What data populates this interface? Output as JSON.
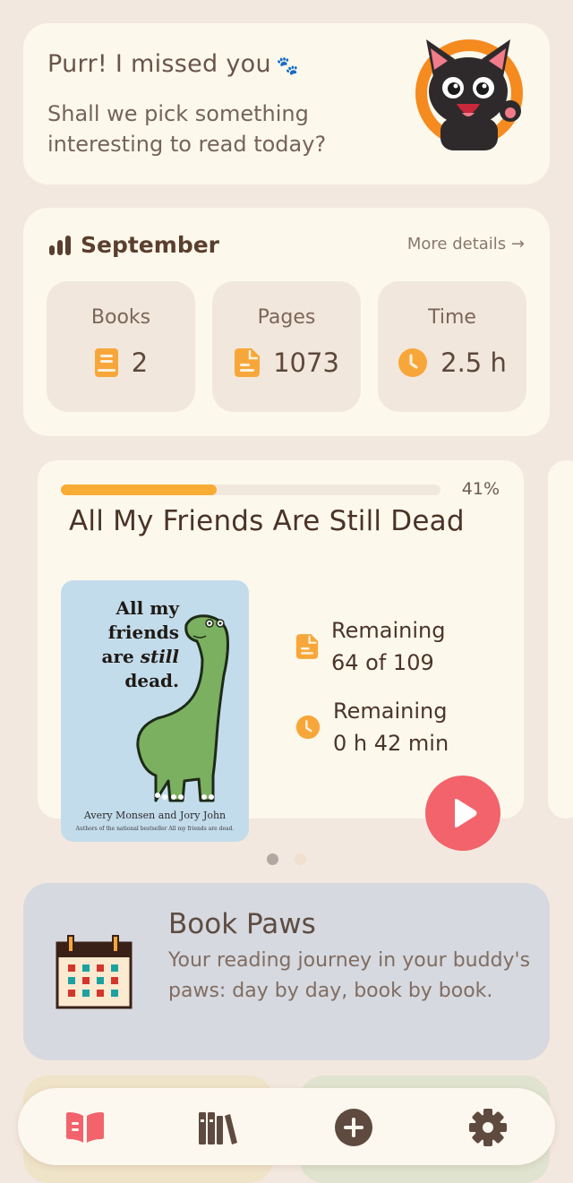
{
  "greeting": {
    "title": "Purr! I missed you",
    "paw": "🐾",
    "subtitle": "Shall we pick something interesting to read today?",
    "mascot_icon": "waving-black-cat"
  },
  "stats": {
    "month": "September",
    "more_details": "More details →",
    "items": [
      {
        "label": "Books",
        "value": "2",
        "icon": "book-icon"
      },
      {
        "label": "Pages",
        "value": "1073",
        "icon": "page-icon"
      },
      {
        "label": "Time",
        "value": "2.5 h",
        "icon": "clock-icon"
      }
    ]
  },
  "current_book": {
    "progress_percent": 41,
    "progress_label": "41%",
    "title": "All My Friends Are Still Dead",
    "cover": {
      "title_line1": "All my",
      "title_line2": "friends",
      "title_line3_a": "are ",
      "title_line3_b": "still",
      "title_line4": "dead.",
      "authors": "Avery Monsen and Jory John",
      "tagline": "Authors of the national bestseller All my friends are dead."
    },
    "pages_label": "Remaining",
    "pages_value": "64 of 109",
    "time_label": "Remaining",
    "time_value": "0 h 42 min"
  },
  "carousel": {
    "active_index": 0,
    "count": 2
  },
  "book_paws": {
    "title": "Book Paws",
    "description": "Your reading journey in your buddy's paws: day by day, book by book."
  },
  "nav": {
    "items": [
      "reading-icon",
      "library-icon",
      "add-icon",
      "settings-icon"
    ],
    "active": "reading-icon"
  },
  "colors": {
    "background": "#f3e8df",
    "card": "#fdf8ec",
    "accent_orange": "#f9ac33",
    "play_red": "#f2636c",
    "book_paws_bg": "#d6d9df"
  }
}
